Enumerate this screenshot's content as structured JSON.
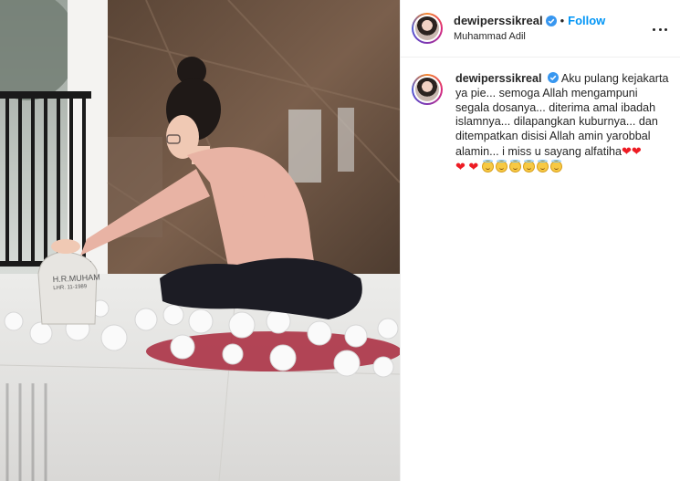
{
  "post": {
    "author": {
      "username": "dewiperssikreal",
      "verified": true,
      "follow_label": "Follow",
      "separator": "•",
      "location": "Muhammad Adil"
    },
    "photo": {
      "headstone_line1": "H.R.MUHAM",
      "headstone_line2": "LHR. 11-1989"
    },
    "caption": {
      "username": "dewiperssikreal",
      "text": "Aku pulang kejakarta ya pie... semoga Allah mengampuni segala dosanya... diterima amal ibadah islamnya... dilapangkan kuburnya... dan ditempatkan disisi Allah amin yarobbal alamin... i miss u sayang alfatiha",
      "emojis_inline": [
        "heart",
        "heart"
      ],
      "emojis_line": [
        "heart",
        "heart",
        "smiling-halo",
        "smiling-halo",
        "smiling-halo",
        "smiling-halo",
        "smiling-halo",
        "smiling-halo"
      ]
    }
  },
  "colors": {
    "follow": "#0095f6",
    "verified": "#3897f0",
    "text": "#262626",
    "heart": "#ed1c24"
  }
}
